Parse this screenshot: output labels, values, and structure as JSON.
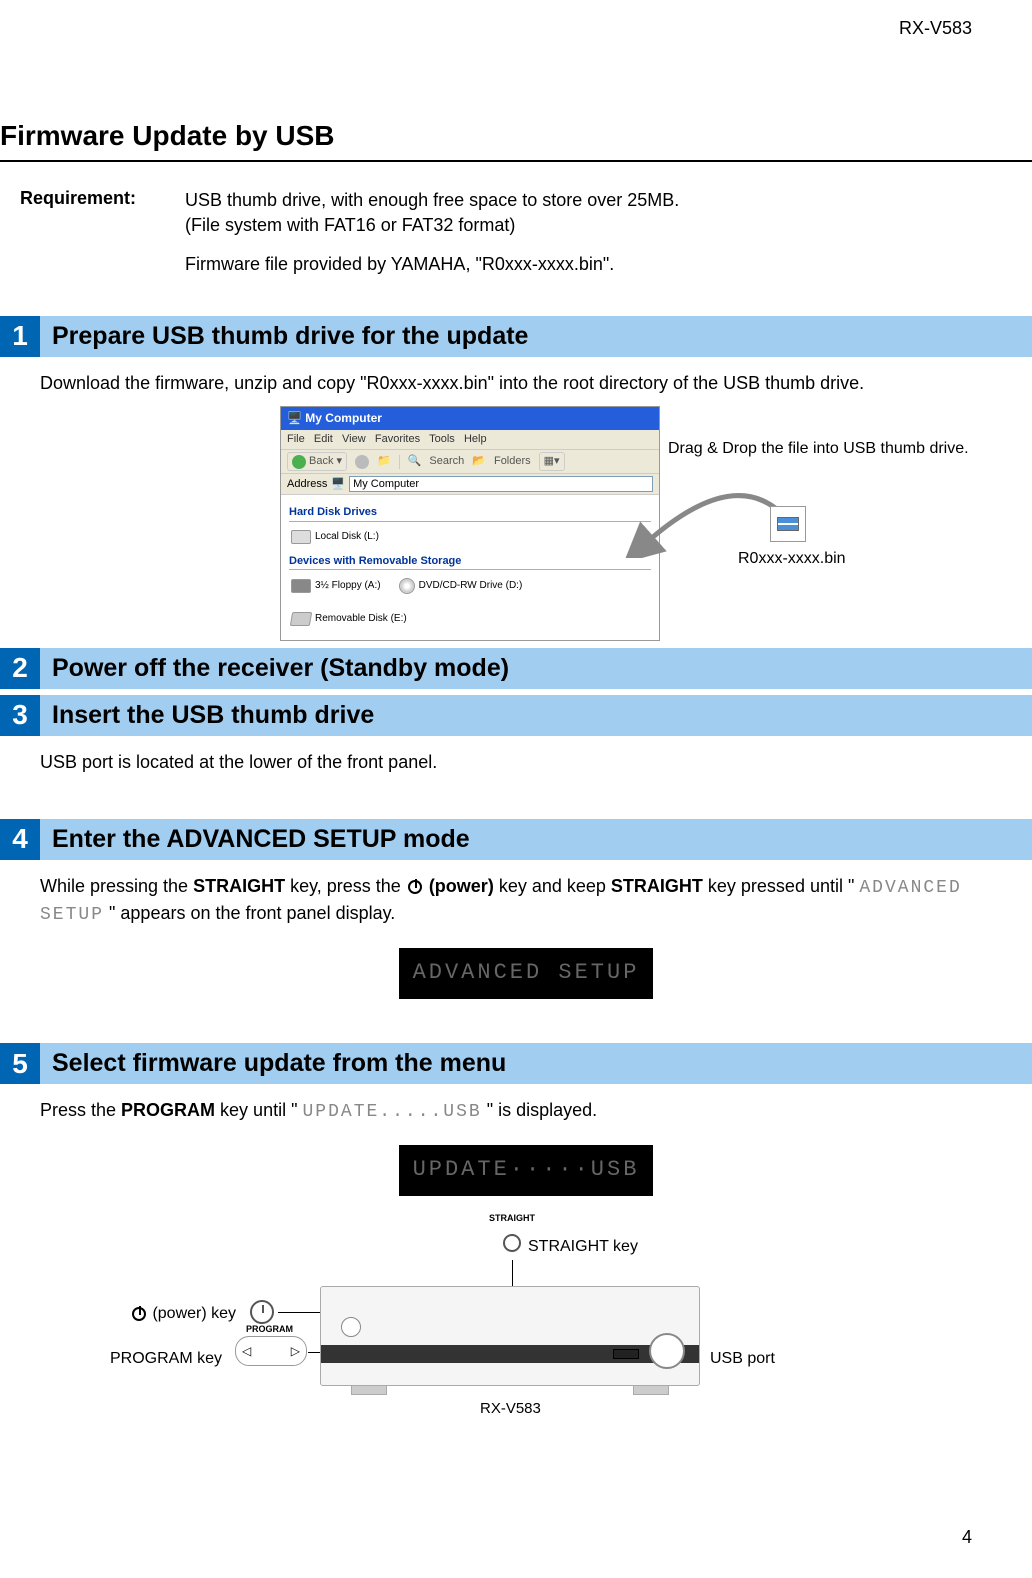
{
  "header": {
    "model": "RX-V583"
  },
  "page": {
    "title": "Firmware Update by USB",
    "number": "4"
  },
  "requirement": {
    "label": "Requirement:",
    "line1": "USB thumb drive, with enough free space to store over 25MB.\n(File system with FAT16 or FAT32 format)",
    "line2": "Firmware file provided by YAMAHA, \"R0xxx-xxxx.bin\"."
  },
  "steps": [
    {
      "num": "1",
      "title": "Prepare USB thumb drive for the update",
      "body": "Download the firmware, unzip and copy \"R0xxx-xxxx.bin\" into the root directory of the USB thumb drive."
    },
    {
      "num": "2",
      "title": "Power off the receiver (Standby mode)"
    },
    {
      "num": "3",
      "title": "Insert the USB thumb drive",
      "body": "USB port is located at the lower of the front panel."
    },
    {
      "num": "4",
      "title": "Enter the ADVANCED SETUP mode",
      "body_prefix": "While pressing the ",
      "key1": "STRAIGHT",
      "mid1": " key, press the ",
      "key_power": "(power)",
      "mid2": " key and keep ",
      "key2": "STRAIGHT",
      "mid3": " key pressed until \" ",
      "seg": "ADVANCED SETUP",
      "suffix": " \" appears on the front panel display.",
      "lcd": "ADVANCED SETUP"
    },
    {
      "num": "5",
      "title": "Select firmware update from the menu",
      "body_prefix": "Press the ",
      "key1": "PROGRAM",
      "mid1": " key until \" ",
      "seg": "UPDATE.....USB",
      "suffix": " \" is displayed.",
      "lcd": "UPDATE·····USB"
    }
  ],
  "figure_explorer": {
    "window_title": "My Computer",
    "menu": [
      "File",
      "Edit",
      "View",
      "Favorites",
      "Tools",
      "Help"
    ],
    "toolbar": {
      "back": "Back",
      "search": "Search",
      "folders": "Folders"
    },
    "address_label": "Address",
    "address_value": "My Computer",
    "section1": "Hard Disk Drives",
    "item_localdisk": "Local Disk (L:)",
    "section2": "Devices with Removable Storage",
    "item_floppy": "3½ Floppy (A:)",
    "item_dvd": "DVD/CD-RW Drive (D:)",
    "item_removable": "Removable Disk (E:)",
    "drag_text": "Drag & Drop the file into USB thumb drive.",
    "file_label": "R0xxx-xxxx.bin"
  },
  "figure_receiver": {
    "straight_label": "STRAIGHT key",
    "power_label": "(power) key",
    "program_label": "PROGRAM key",
    "usb_label": "USB port",
    "model_below": "RX-V583",
    "straight_small": "STRAIGHT",
    "program_small": "PROGRAM"
  }
}
